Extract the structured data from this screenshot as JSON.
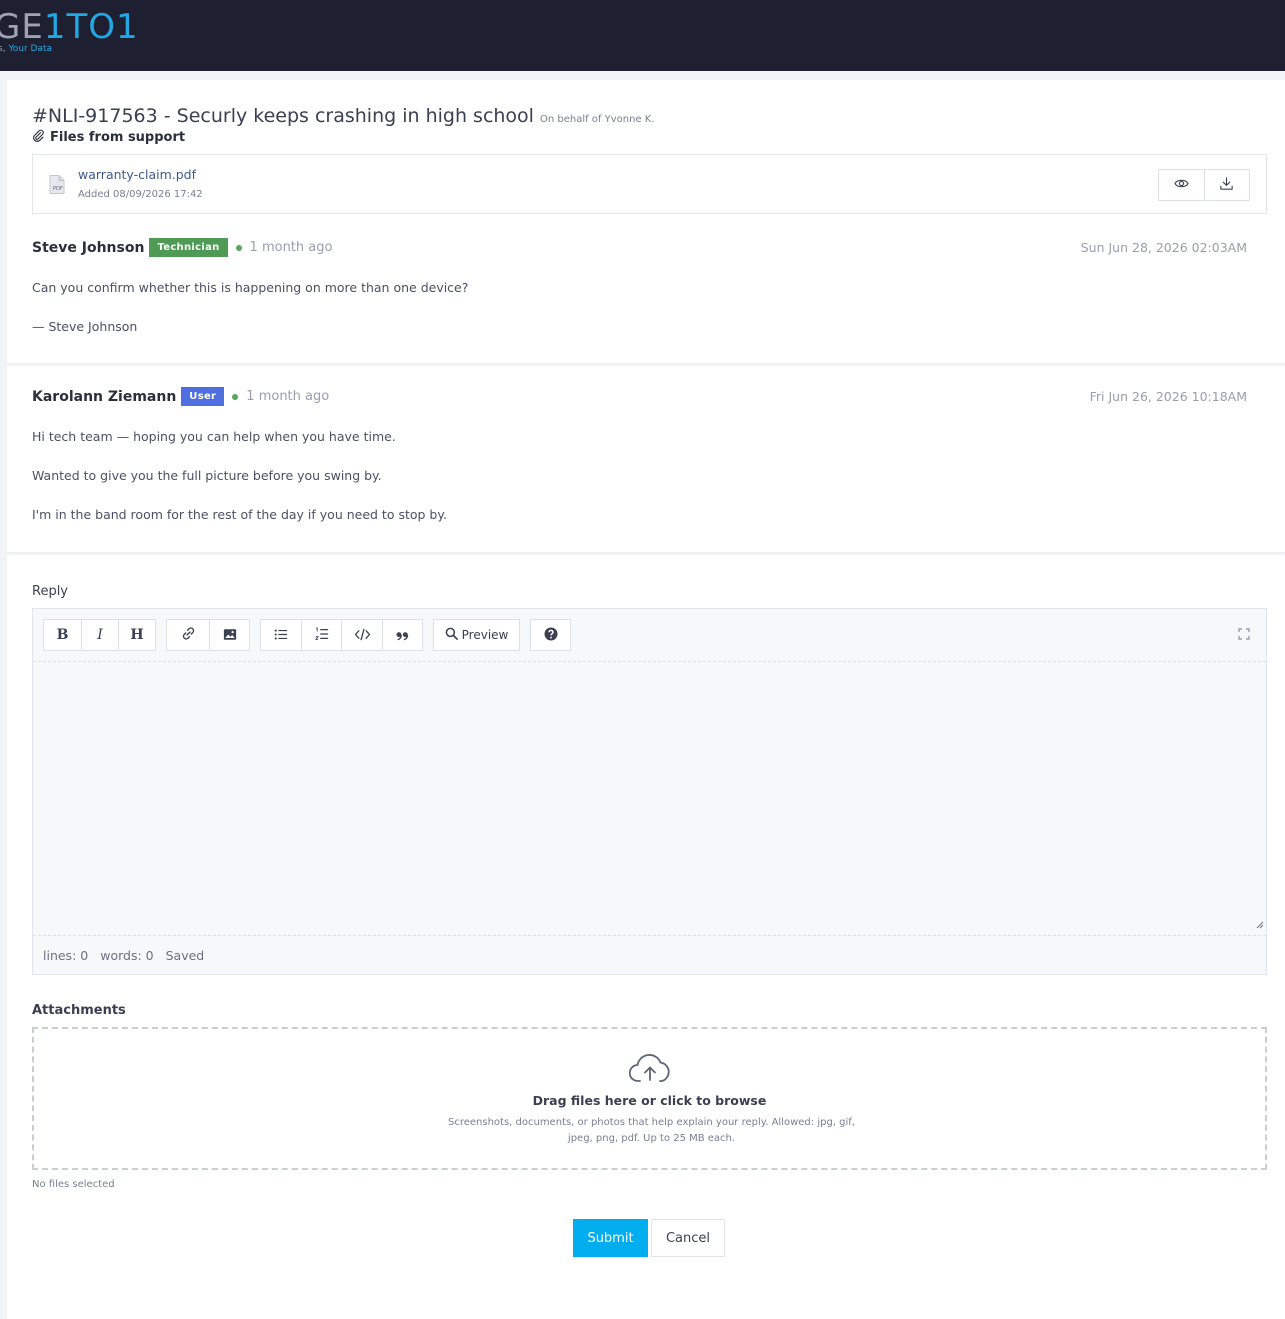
{
  "brand": {
    "logo_part1": "GE",
    "logo_part2": "1TO1",
    "tagline_part1": "s,",
    "tagline_part2": "Your Data",
    "colors": {
      "topbar": "#1e1f30",
      "accent": "#20a8e6"
    }
  },
  "ticket": {
    "title": "#NLI-917563 - Securly keeps crashing in high school",
    "on_behalf": "On behalf of Yvonne K.",
    "files_label": "Files from support",
    "file": {
      "icon": "pdf-file-icon",
      "icon_text": "PDF",
      "name": "warranty-claim.pdf",
      "added": "Added 08/09/2026 17:42",
      "view_icon": "eye-icon",
      "download_icon": "download-icon"
    }
  },
  "posts": [
    {
      "author": "Steve Johnson",
      "role": "Technician",
      "role_color": "#4f9a55",
      "ago": "1 month ago",
      "date": "Sun Jun 28, 2026 02:03AM",
      "lines": [
        "Can you confirm whether this is happening on more than one device?",
        "— Steve Johnson"
      ]
    },
    {
      "author": "Karolann Ziemann",
      "role": "User",
      "role_color": "#4f6fe0",
      "ago": "1 month ago",
      "date": "Fri Jun 26, 2026 10:18AM",
      "lines": [
        "Hi tech team — hoping you can help when you have time.",
        "Wanted to give you the full picture before you swing by.",
        "I'm in the band room for the rest of the day if you need to stop by."
      ]
    }
  ],
  "reply": {
    "label": "Reply",
    "toolbar": {
      "bold": "B",
      "italic": "I",
      "heading": "H",
      "preview_label": "Preview",
      "icons": [
        "link-icon",
        "image-icon",
        "bullet-list-icon",
        "numbered-list-icon",
        "code-icon",
        "quote-icon",
        "search-icon",
        "help-icon",
        "fullscreen-icon"
      ]
    },
    "status": {
      "lines": "lines: 0",
      "words": "words: 0",
      "saved": "Saved"
    }
  },
  "attachments": {
    "label": "Attachments",
    "drop_title": "Drag files here or click to browse",
    "drop_hint": "Screenshots, documents, or photos that help explain your reply. Allowed: jpg, gif, jpeg, png, pdf. Up to 25 MB each.",
    "no_files": "No files selected",
    "icon": "cloud-upload-icon"
  },
  "actions": {
    "submit": "Submit",
    "cancel": "Cancel",
    "submit_color": "#00aef0"
  }
}
